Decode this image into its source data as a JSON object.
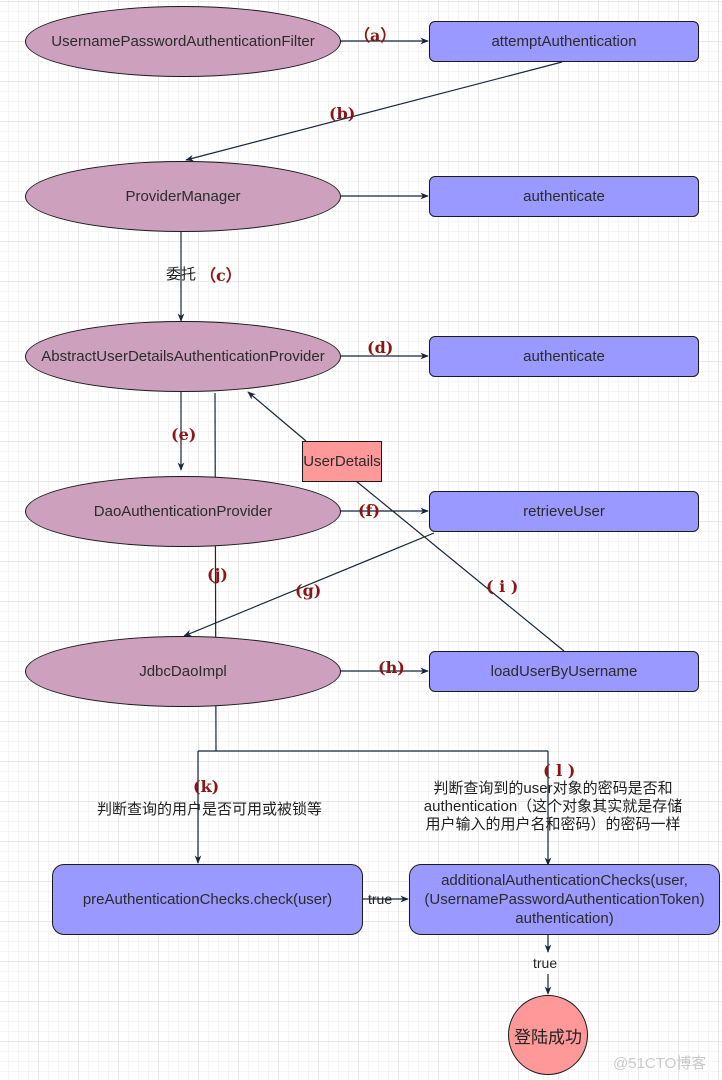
{
  "diagram": {
    "nodes": {
      "filter": "UsernamePasswordAuthenticationFilter",
      "attempt": "attemptAuthentication",
      "provider_manager": "ProviderManager",
      "pm_authenticate": "authenticate",
      "abstract_provider": "AbstractUserDetailsAuthenticationProvider",
      "ap_authenticate": "authenticate",
      "dao_provider": "DaoAuthenticationProvider",
      "retrieve_user": "retrieveUser",
      "jdbc_dao": "JdbcDaoImpl",
      "load_user": "loadUserByUsername",
      "user_details": "UserDetails",
      "pre_checks": "preAuthenticationChecks.check(user)",
      "additional_checks_line1": "additionalAuthenticationChecks(user,",
      "additional_checks_line2": "(UsernamePasswordAuthenticationToken)",
      "additional_checks_line3": "authentication)",
      "success": "登陆成功"
    },
    "edge_labels": {
      "a": "（a）",
      "b": "(b)",
      "c_prefix": "委托",
      "c": "（c）",
      "d": "(d)",
      "e": "(e)",
      "f": "(f)",
      "g": "(g)",
      "h": "(h)",
      "i": "( i )",
      "j": "(j)",
      "k": "(k)",
      "l": "( l )",
      "true_1": "true",
      "true_2": "true"
    },
    "notes": {
      "k_note": "判断查询的用户是否可用或被锁等",
      "l_note_line1": "判断查询到的user对象的密码是否和",
      "l_note_line2": "authentication（这个对象其实就是存储",
      "l_note_line3": "用户输入的用户名和密码）的密码一样"
    },
    "colors": {
      "ellipse_fill": "#cda1bd",
      "box_fill": "#9999ff",
      "note_fill": "#ff9999",
      "edge_label": "#8b1515",
      "edge_line": "#15273a"
    }
  },
  "watermark": "@51CTO博客"
}
